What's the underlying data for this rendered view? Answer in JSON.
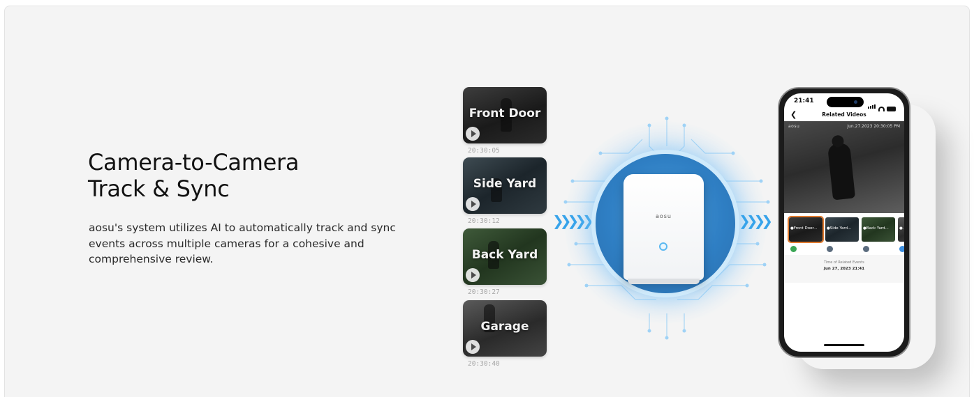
{
  "headline": {
    "line1": "Camera-to-Camera",
    "line2": "Track & Sync"
  },
  "description": "aosu's system utilizes AI to automatically track and sync events across multiple cameras for a cohesive and comprehensive review.",
  "clips": [
    {
      "label": "Front Door",
      "time": "20:30:05"
    },
    {
      "label": "Side Yard",
      "time": "20:30:12"
    },
    {
      "label": "Back Yard",
      "time": "20:30:27"
    },
    {
      "label": "Garage",
      "time": "20:30:40"
    }
  ],
  "hub": {
    "brand": "aosu"
  },
  "phone": {
    "clock": "21:41",
    "title": "Related Videos",
    "video_brand": "aosu",
    "video_timestamp": "Jun.27.2023 20:30:05 PM",
    "thumbnails": [
      {
        "label": "●Front Door..."
      },
      {
        "label": "●Side Yard..."
      },
      {
        "label": "●Back Yard..."
      },
      {
        "label": "●..."
      }
    ],
    "related_caption": "Time of Related Events",
    "related_value": "Jun 27, 2023 21:41"
  },
  "colors": {
    "accent": "#37a3ea",
    "hub_blue": "#2f7fc4",
    "active_outline": "#e07a2e"
  }
}
